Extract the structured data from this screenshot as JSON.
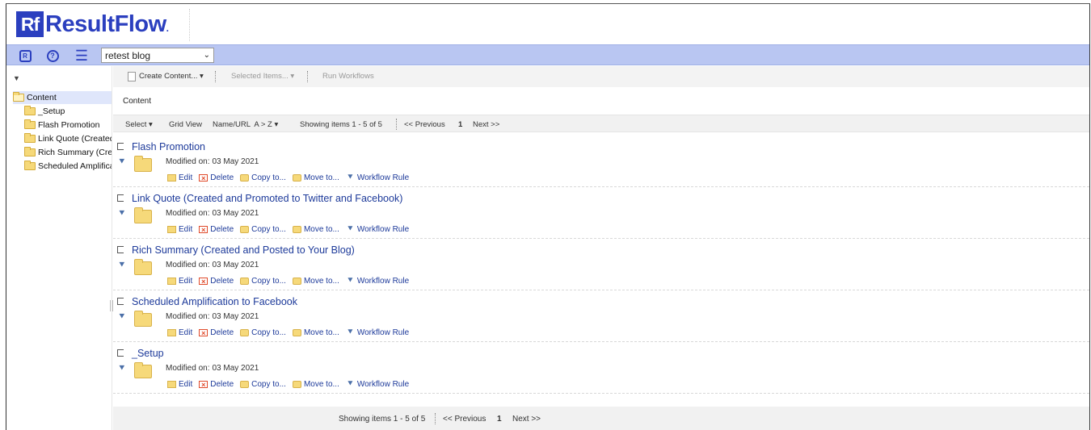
{
  "brand": {
    "mark": "Rf",
    "name": "ResultFlow",
    "suffix": "."
  },
  "toolbar": {
    "home_icon": "home-badge-icon",
    "help_icon": "help-circle-icon",
    "menu_icon": "hamburger-menu-icon",
    "blog_select_value": "retest blog"
  },
  "sidebar": {
    "root": "Content",
    "items": [
      "_Setup",
      "Flash Promotion",
      "Link Quote (Created",
      "Rich Summary (Crea",
      "Scheduled Amplifica"
    ]
  },
  "actions": {
    "create": "Create Content...",
    "selected": "Selected Items...",
    "run": "Run Workflows"
  },
  "breadcrumb": "Content",
  "listbar": {
    "select": "Select",
    "grid_view": "Grid View",
    "sort": "Name/URL  A > Z",
    "showing": "Showing items 1 - 5 of 5",
    "previous": "<< Previous",
    "page": "1",
    "next": "Next >>"
  },
  "row_labels": {
    "modified_label": "Modified on:",
    "edit": "Edit",
    "delete": "Delete",
    "copy": "Copy to...",
    "move": "Move to...",
    "workflow": "Workflow Rule"
  },
  "items": [
    {
      "title": "Flash Promotion",
      "modified": "03 May 2021"
    },
    {
      "title": "Link Quote (Created and Promoted to Twitter and Facebook)",
      "modified": "03 May 2021"
    },
    {
      "title": "Rich Summary (Created and Posted to Your Blog)",
      "modified": "03 May 2021"
    },
    {
      "title": "Scheduled Amplification to Facebook",
      "modified": "03 May 2021"
    },
    {
      "title": "_Setup",
      "modified": "03 May 2021"
    }
  ],
  "footer": {
    "showing": "Showing items 1 - 5 of 5",
    "previous": "<< Previous",
    "page": "1",
    "next": "Next >>"
  },
  "colors": {
    "brand": "#2b3fbf",
    "toolbar": "#b9c6f2",
    "link": "#1d3a9a",
    "folder": "#f6d97a"
  }
}
